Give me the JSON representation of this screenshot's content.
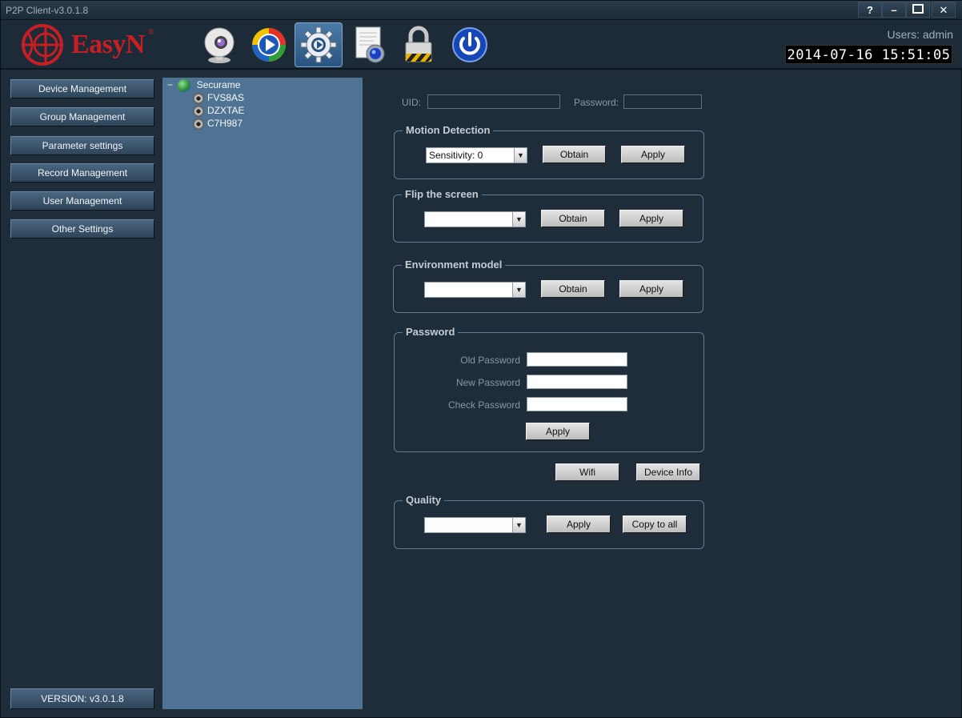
{
  "window": {
    "title": "P2P Client-v3.0.1.8",
    "controls": {
      "help": "?",
      "minimize": "–",
      "maximize": "□",
      "close": "✕"
    }
  },
  "header": {
    "logo_text": "EasyN",
    "logo_reg": "®",
    "users_label": "Users: admin",
    "clock": "2014-07-16 15:51:05",
    "toolbar": [
      {
        "name": "live-view",
        "icon": "webcam-icon"
      },
      {
        "name": "playback",
        "icon": "play-icon"
      },
      {
        "name": "settings",
        "icon": "gear-icon",
        "active": true
      },
      {
        "name": "log",
        "icon": "log-icon"
      },
      {
        "name": "lock",
        "icon": "lock-icon"
      },
      {
        "name": "exit",
        "icon": "power-icon"
      }
    ]
  },
  "sidebar": {
    "items": [
      {
        "label": "Device Management"
      },
      {
        "label": "Group Management"
      },
      {
        "label": "Parameter settings"
      },
      {
        "label": "Record Management"
      },
      {
        "label": "User Management"
      },
      {
        "label": "Other Settings"
      }
    ],
    "version": "VERSION: v3.0.1.8"
  },
  "tree": {
    "expander": "−",
    "root": "Securame",
    "devices": [
      "FVS8AS",
      "DZXTAE",
      "C7H987"
    ]
  },
  "main": {
    "uid_label": "UID:",
    "uid_value": "",
    "password_label": "Password:",
    "password_value": "",
    "motion": {
      "legend": "Motion Detection",
      "select_value": "Sensitivity: 0",
      "obtain": "Obtain",
      "apply": "Apply"
    },
    "flip": {
      "legend": "Flip the screen",
      "select_value": "",
      "obtain": "Obtain",
      "apply": "Apply"
    },
    "environment": {
      "legend": "Environment model",
      "select_value": "",
      "obtain": "Obtain",
      "apply": "Apply"
    },
    "password_group": {
      "legend": "Password",
      "old_label": "Old Password",
      "new_label": "New Password",
      "check_label": "Check Password",
      "apply": "Apply"
    },
    "wifi": "Wifi",
    "device_info": "Device Info",
    "quality": {
      "legend": "Quality",
      "select_value": "",
      "apply": "Apply",
      "copy_all": "Copy to all"
    }
  },
  "colors": {
    "background": "#1f2d3a",
    "tree_panel": "#4f7393",
    "brand_red": "#c41f24",
    "active_tool": "#3f6d99"
  }
}
